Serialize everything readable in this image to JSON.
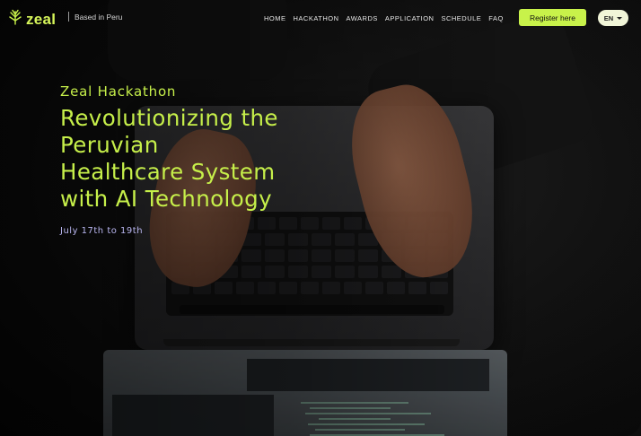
{
  "brand": {
    "name": "zeal",
    "tagline": "Based in Peru",
    "accent_color": "#c8f24a"
  },
  "nav": {
    "items": [
      {
        "label": "HOME"
      },
      {
        "label": "HACKATHON"
      },
      {
        "label": "AWARDS"
      },
      {
        "label": "APPLICATION"
      },
      {
        "label": "SCHEDULE"
      },
      {
        "label": "FAQ"
      }
    ],
    "register_label": "Register here",
    "language": "EN"
  },
  "hero": {
    "eyebrow": "Zeal Hackathon",
    "headline_lines": [
      "Revolutionizing the",
      "Peruvian",
      "Healthcare System",
      "with AI Technology"
    ],
    "dates": "July 17th to 19th",
    "dates_color": "#b9b6f0"
  },
  "icons": {
    "logo": "tree-logo-icon",
    "language_caret": "caret-down-icon"
  }
}
